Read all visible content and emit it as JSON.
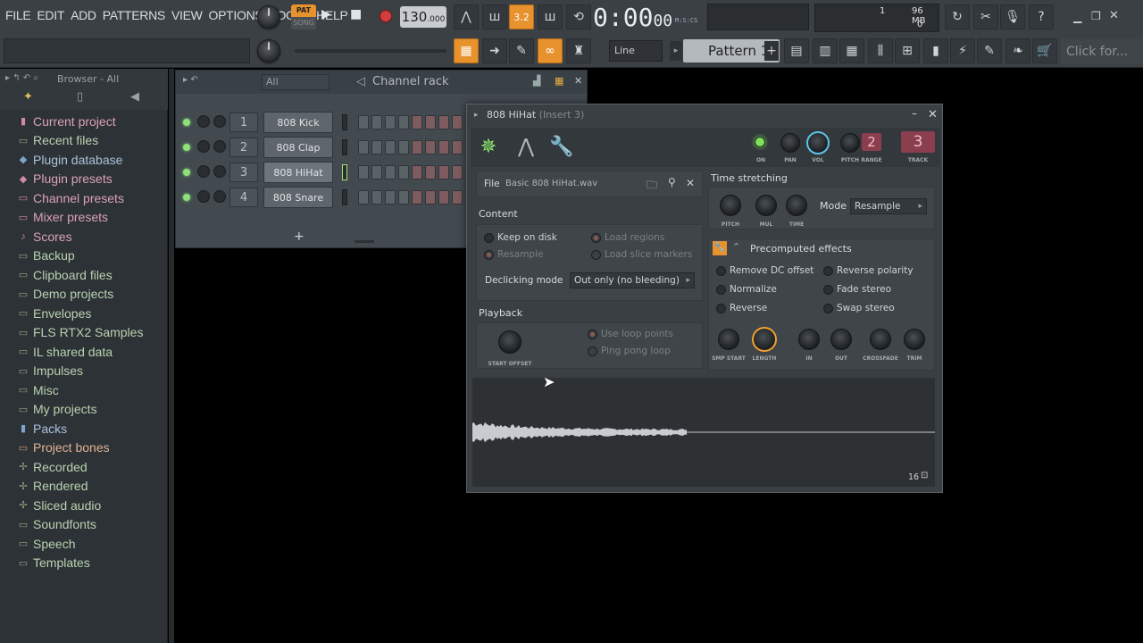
{
  "menu": [
    "FILE",
    "EDIT",
    "ADD",
    "PATTERNS",
    "VIEW",
    "OPTIONS",
    "TOOLS",
    "HELP"
  ],
  "transport": {
    "pat_label": "PAT",
    "song_label": "SONG",
    "tempo": "130",
    "tempo_decimal": ".000",
    "time": "0:00",
    "time_small": "00",
    "time_format": "M:S:CS",
    "step": "3.2"
  },
  "cpu": {
    "value": "1",
    "memory": "96 MB",
    "poly": "0"
  },
  "toolbar2": {
    "snap_mode": "Line",
    "pattern": "Pattern 1",
    "hint": "Click for..."
  },
  "browser": {
    "title": "Browser - All",
    "items": [
      {
        "label": "Current project",
        "icon": "▮"
      },
      {
        "label": "Recent files",
        "icon": "▭"
      },
      {
        "label": "Plugin database",
        "icon": "◆"
      },
      {
        "label": "Plugin presets",
        "icon": "◆"
      },
      {
        "label": "Channel presets",
        "icon": "▭"
      },
      {
        "label": "Mixer presets",
        "icon": "▭"
      },
      {
        "label": "Scores",
        "icon": "♪"
      },
      {
        "label": "Backup",
        "icon": "▭"
      },
      {
        "label": "Clipboard files",
        "icon": "▭"
      },
      {
        "label": "Demo projects",
        "icon": "▭"
      },
      {
        "label": "Envelopes",
        "icon": "▭"
      },
      {
        "label": "FLS RTX2 Samples",
        "icon": "▭"
      },
      {
        "label": "IL shared data",
        "icon": "▭"
      },
      {
        "label": "Impulses",
        "icon": "▭"
      },
      {
        "label": "Misc",
        "icon": "▭"
      },
      {
        "label": "My projects",
        "icon": "▭"
      },
      {
        "label": "Packs",
        "icon": "▮"
      },
      {
        "label": "Project bones",
        "icon": "▭"
      },
      {
        "label": "Recorded",
        "icon": "✢"
      },
      {
        "label": "Rendered",
        "icon": "✢"
      },
      {
        "label": "Sliced audio",
        "icon": "✢"
      },
      {
        "label": "Soundfonts",
        "icon": "▭"
      },
      {
        "label": "Speech",
        "icon": "▭"
      },
      {
        "label": "Templates",
        "icon": "▭"
      }
    ]
  },
  "channel_rack": {
    "title": "Channel rack",
    "filter": "All",
    "channels": [
      {
        "num": "1",
        "name": "808 Kick"
      },
      {
        "num": "2",
        "name": "808 Clap"
      },
      {
        "num": "3",
        "name": "808 HiHat"
      },
      {
        "num": "4",
        "name": "808 Snare"
      }
    ],
    "add": "+"
  },
  "plugin": {
    "title": "808 HiHat",
    "insert": "(Insert 3)",
    "knob_labels": {
      "on": "ON",
      "pan": "PAN",
      "vol": "VOL",
      "pitch": "PITCH",
      "range": "RANGE",
      "track": "TRACK"
    },
    "range_value": "2",
    "track_value": "3",
    "file_label": "File",
    "file_name": "Basic 808 HiHat.wav",
    "content_title": "Content",
    "keep_on_disk": "Keep on disk",
    "resample": "Resample",
    "load_regions": "Load regions",
    "load_slice_markers": "Load slice markers",
    "declicking_label": "Declicking mode",
    "declicking_value": "Out only (no bleeding)",
    "playback_title": "Playback",
    "start_offset": "START OFFSET",
    "use_loop_points": "Use loop points",
    "ping_pong_loop": "Ping pong loop",
    "time_stretching": "Time stretching",
    "ts_pitch": "PITCH",
    "ts_mul": "MUL",
    "ts_time": "TIME",
    "mode_label": "Mode",
    "mode_value": "Resample",
    "precomputed": "Precomputed effects",
    "remove_dc": "Remove DC offset",
    "normalize": "Normalize",
    "reverse": "Reverse",
    "reverse_polarity": "Reverse polarity",
    "fade_stereo": "Fade stereo",
    "swap_stereo": "Swap stereo",
    "fx_knobs": [
      "SMP START",
      "LENGTH",
      "IN",
      "OUT",
      "CROSSFADE",
      "TRIM"
    ],
    "wave_zoom": "16"
  }
}
